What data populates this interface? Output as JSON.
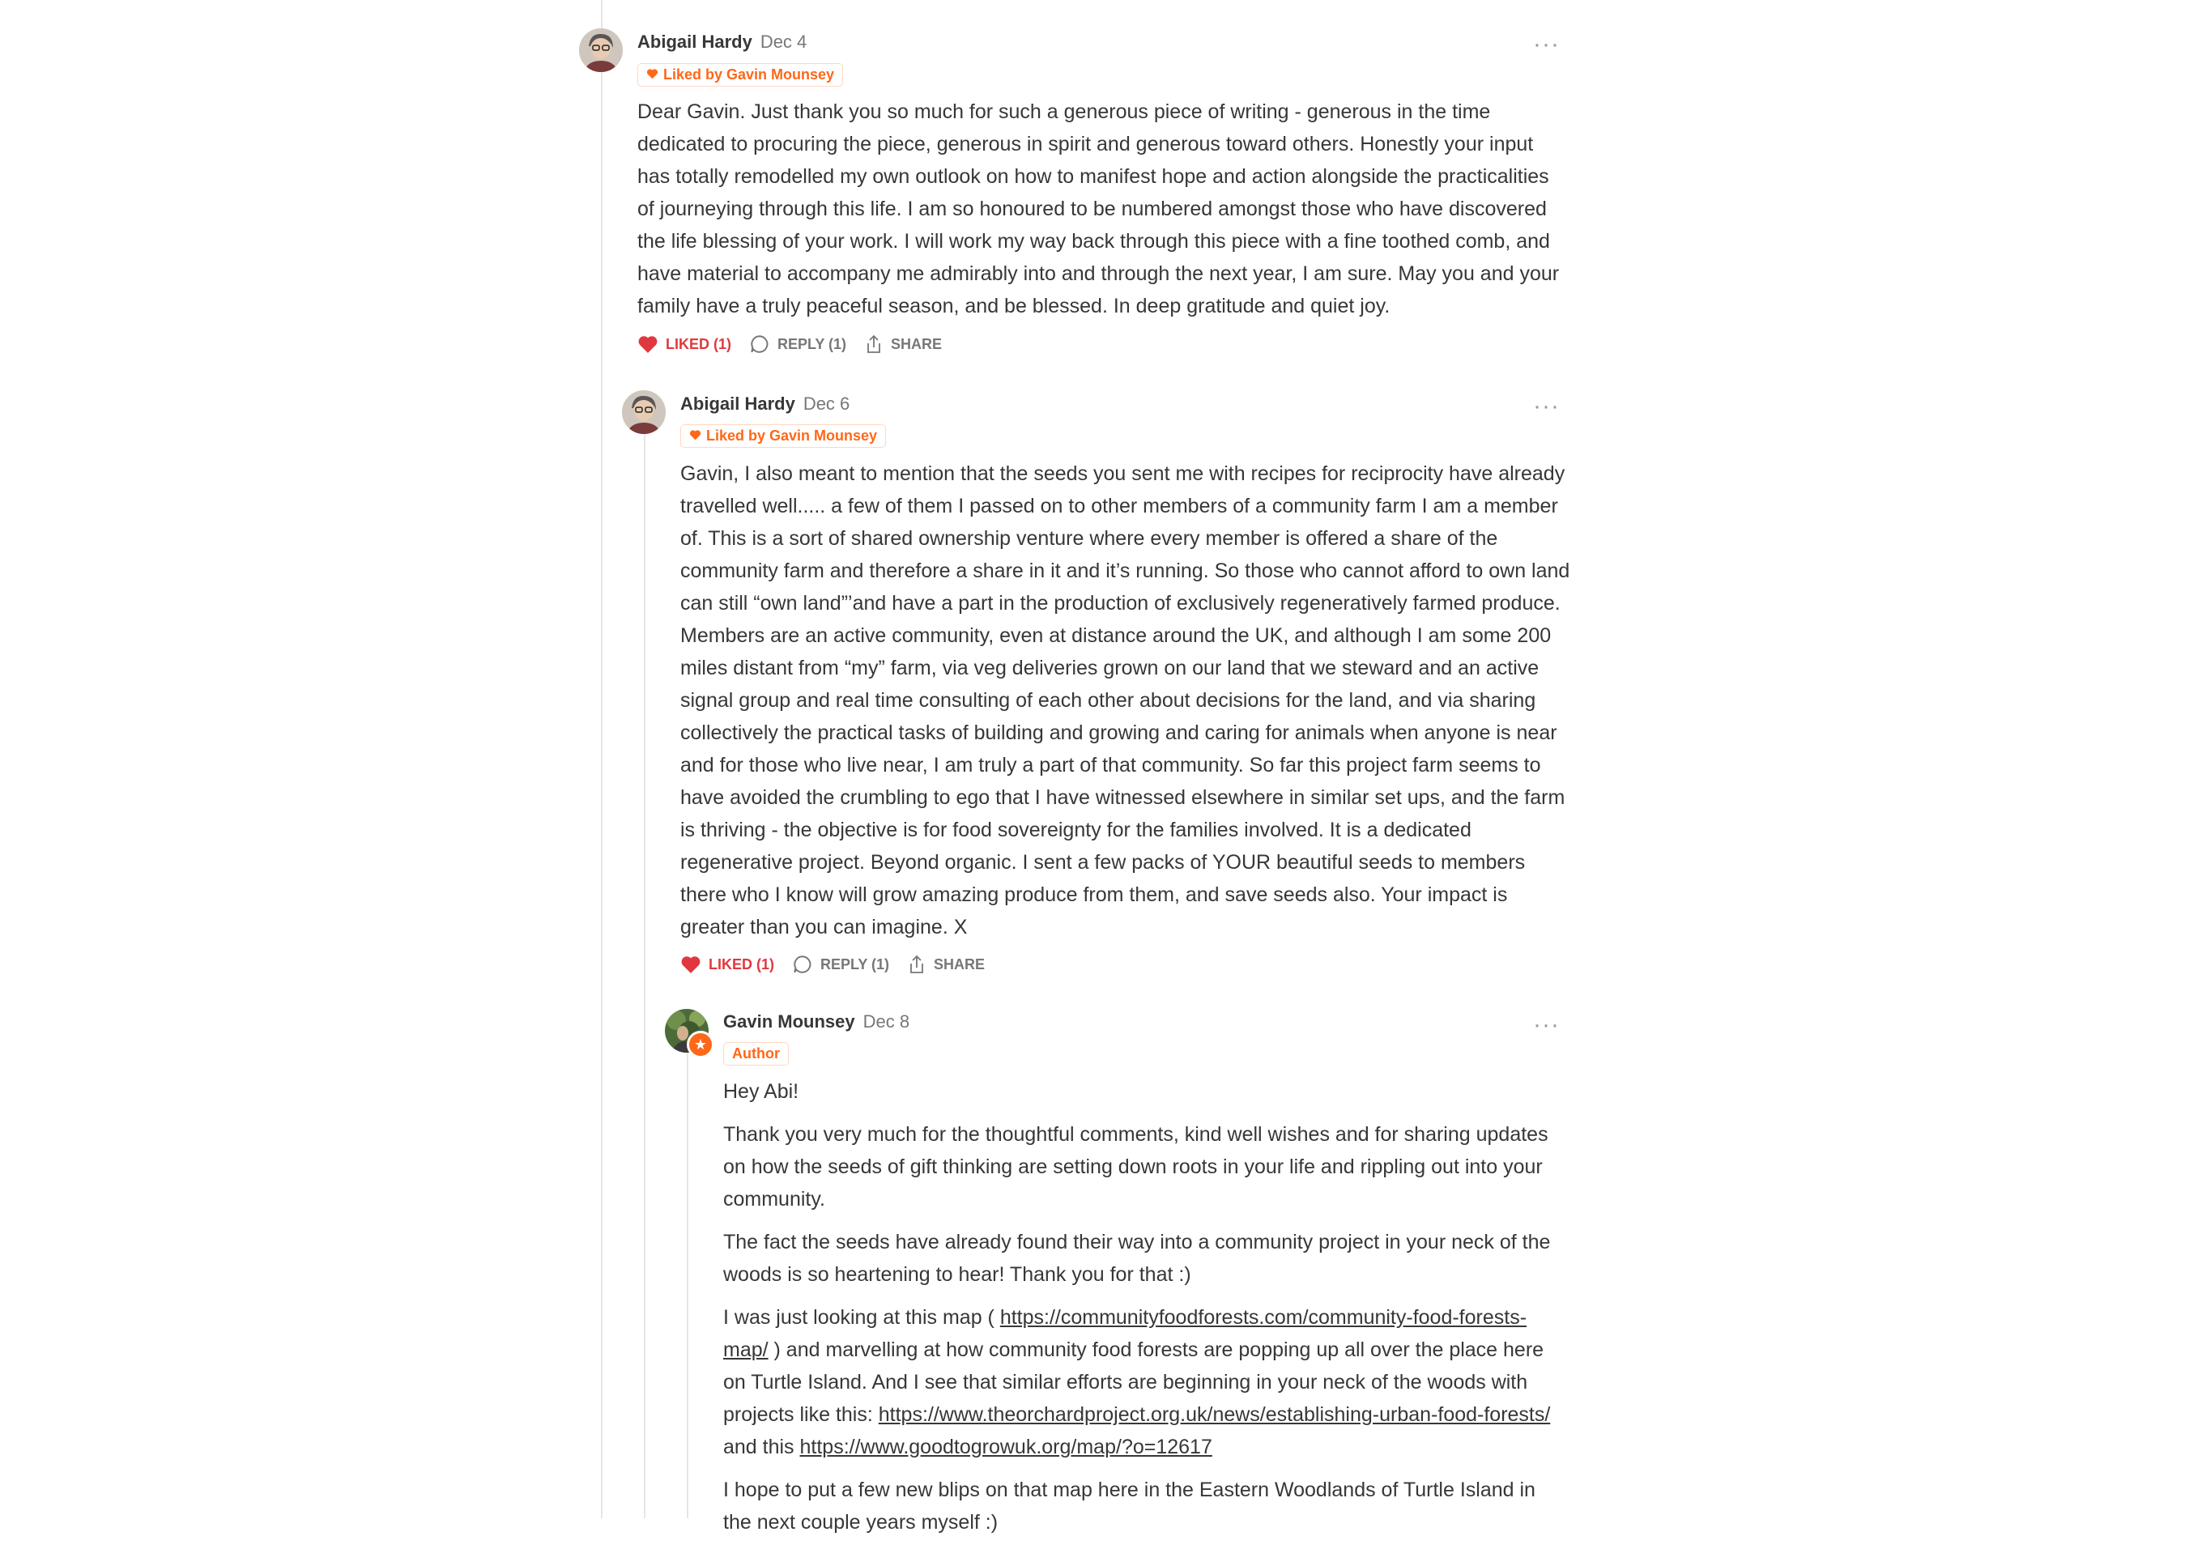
{
  "comments": [
    {
      "name": "Abigail Hardy",
      "date": "Dec 4",
      "badge": "Liked by Gavin Mounsey",
      "paragraphs": [
        "Dear Gavin. Just thank you so much for such a generous piece of writing - generous in the time dedicated to procuring the piece, generous in spirit and generous toward others. Honestly your input has totally remodelled my own outlook on how to manifest hope and action alongside the practicalities of journeying through this life. I am so honoured to be numbered amongst those who have discovered the life blessing of your work. I will work my way back through this piece with a fine toothed comb, and have material to accompany me admirably into and through the next year, I am sure. May you and your family have a truly peaceful season, and be blessed. In deep gratitude and quiet joy."
      ],
      "like_label": "LIKED (1)",
      "reply_label": "REPLY (1)",
      "share_label": "SHARE"
    },
    {
      "name": "Abigail Hardy",
      "date": "Dec 6",
      "badge": "Liked by Gavin Mounsey",
      "paragraphs": [
        "Gavin, I also meant to mention that the seeds you sent me with recipes for reciprocity have already travelled well..... a few of them I passed on to other members of a community farm I am a member of. This is a sort of shared ownership venture where every member is offered a share of the community farm and therefore a share in it and it’s running. So those who cannot afford to own land can still “own land”’and have a part in the production of exclusively regeneratively farmed produce. Members are an active community, even at distance around the UK, and although I am some 200 miles distant from “my” farm, via veg deliveries grown on our land that we steward and an active signal group and real time consulting of each other about decisions for the land, and via sharing collectively the practical tasks of building and growing and caring for animals when anyone is near and for those who live near, I am truly a part of that community. So far this project farm seems to have avoided the crumbling to ego that I have witnessed elsewhere in similar set ups, and the farm is thriving - the objective is for food sovereignty for the families involved. It is a dedicated regenerative project. Beyond organic. I sent a few packs of YOUR beautiful seeds to members there who I know will grow amazing produce from them, and save seeds also. Your impact is greater than you can imagine. X"
      ],
      "like_label": "LIKED (1)",
      "reply_label": "REPLY (1)",
      "share_label": "SHARE"
    },
    {
      "name": "Gavin Mounsey",
      "date": "Dec 8",
      "badge": "Author",
      "p1": "Hey Abi!",
      "p2": "Thank you very much for the thoughtful comments, kind well wishes and for sharing updates on how the seeds of gift thinking are setting down roots in your life and rippling out into your community.",
      "p3": "The fact the seeds have already found their way into a community project in your neck of the woods is so heartening to hear! Thank you for that :)",
      "p4_a": "I was just looking at this map ( ",
      "link1": "https://communityfoodforests.com/community-food-forests-map/",
      "p4_b": " ) and marvelling at how community food forests are popping up all over the place here on Turtle Island. And I see that similar efforts are beginning in your neck of the woods with projects like this: ",
      "link2": "https://www.theorchardproject.org.uk/news/establishing-urban-food-forests/",
      "p4_c": " and this ",
      "link3": "https://www.goodtogrowuk.org/map/?o=12617",
      "p5": "I hope to put a few new blips on that map here in the Eastern Woodlands of Turtle Island in the next couple years myself :)"
    }
  ],
  "icons": {
    "more": "ellipsis-icon",
    "like": "heart-icon",
    "reply": "speech-bubble-icon",
    "share": "share-icon",
    "author": "star-icon"
  },
  "colors": {
    "accent": "#ff6719",
    "liked": "#e0383e",
    "text": "#363737",
    "muted": "#777777",
    "thread_line": "#e5e5e5"
  }
}
